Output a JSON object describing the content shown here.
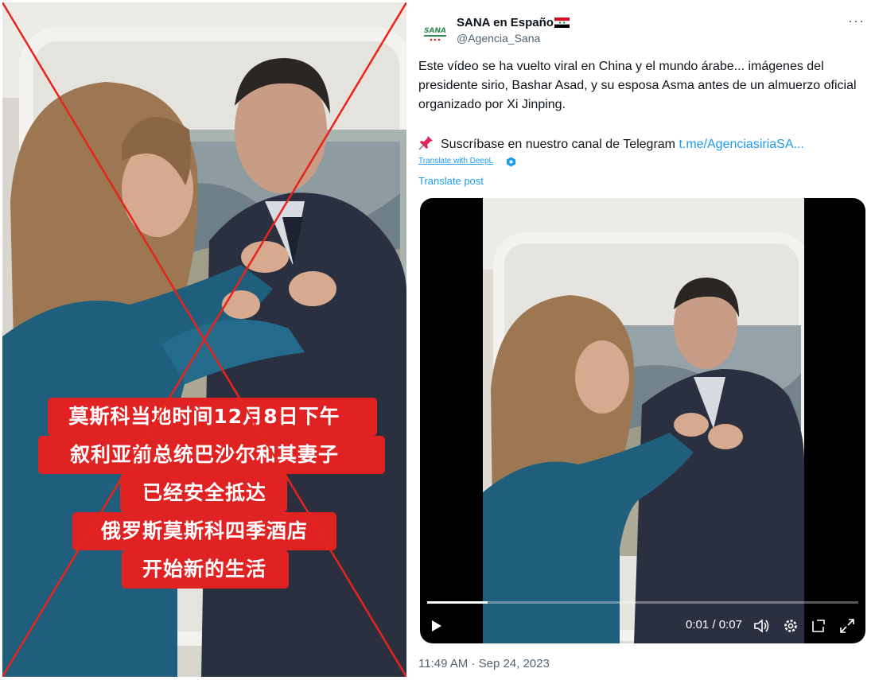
{
  "left_image": {
    "caption_lines": [
      "莫斯科当地时间12月8日下午",
      "叙利亚前总统巴沙尔和其妻子",
      "已经安全抵达",
      "俄罗斯莫斯科四季酒店",
      "开始新的生活"
    ],
    "overlay_mark": "red-x-cross"
  },
  "tweet": {
    "display_name": "SANA en Español",
    "handle": "@Agencia_Sana",
    "avatar_logo_text": "SANA",
    "verified_flag": "syria-flag-icon",
    "more_icon": "···",
    "text": "Este vídeo se ha vuelto viral en China y el mundo árabe... imágenes del presidente sirio, Bashar Asad, y su esposa Asma antes de un almuerzo oficial organizado por Xi Jinping.",
    "telegram_prefix": "Suscríbase en nuestro canal de Telegram ",
    "telegram_link": "t.me/AgenciasiriaSA...",
    "deepl_label": "Translate with DeepL",
    "translate_post": "Translate post",
    "video": {
      "current_time": "0:01",
      "separator": " / ",
      "duration": "0:07",
      "progress_fraction": 0.14
    },
    "timestamp": "11:49 AM · Sep 24, 2023"
  },
  "colors": {
    "accent_link": "#1d9bf0",
    "caption_red": "#e02222",
    "cross_red": "#e8231c",
    "muted": "#536471"
  }
}
